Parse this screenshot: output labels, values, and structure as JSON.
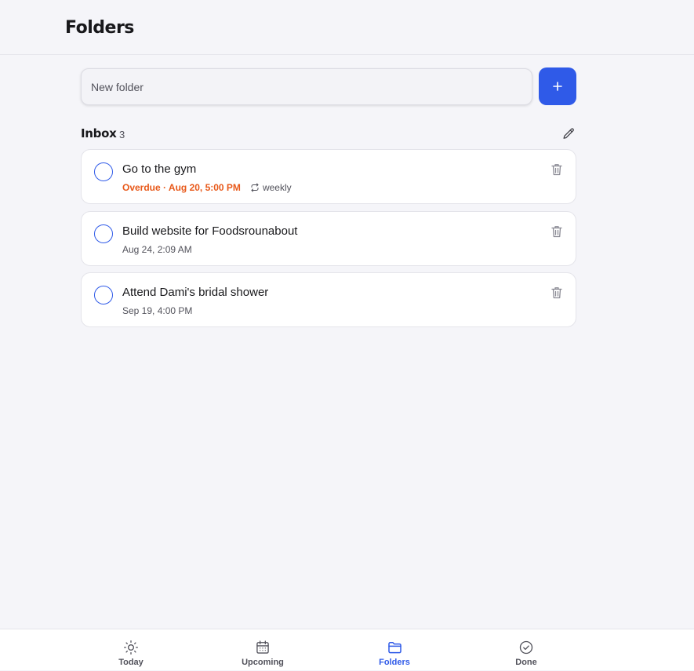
{
  "header": {
    "title": "Folders"
  },
  "new_folder": {
    "placeholder": "New folder",
    "value": ""
  },
  "add_button": {
    "icon": "plus-icon",
    "label": "+"
  },
  "folder": {
    "name": "Inbox",
    "count": "3",
    "edit_icon": "pencil-icon"
  },
  "tasks": [
    {
      "title": "Go to the gym",
      "due": "Overdue · Aug 20, 5:00 PM",
      "overdue": true,
      "repeat": "weekly"
    },
    {
      "title": "Build website for Foodsrounabout",
      "due": "Aug 24, 2:09 AM",
      "overdue": false
    },
    {
      "title": "Attend Dami's bridal shower",
      "due": "Sep 19, 4:00 PM",
      "overdue": false
    }
  ],
  "nav": {
    "items": [
      {
        "label": "Today",
        "icon": "sun-icon",
        "active": false
      },
      {
        "label": "Upcoming",
        "icon": "calendar-icon",
        "active": false
      },
      {
        "label": "Folders",
        "icon": "folder-icon",
        "active": true
      },
      {
        "label": "Done",
        "icon": "check-circle-icon",
        "active": false
      }
    ]
  },
  "colors": {
    "accent": "#2f5ae8",
    "overdue": "#e8591a",
    "background": "#f5f5f9",
    "card": "#ffffff"
  }
}
